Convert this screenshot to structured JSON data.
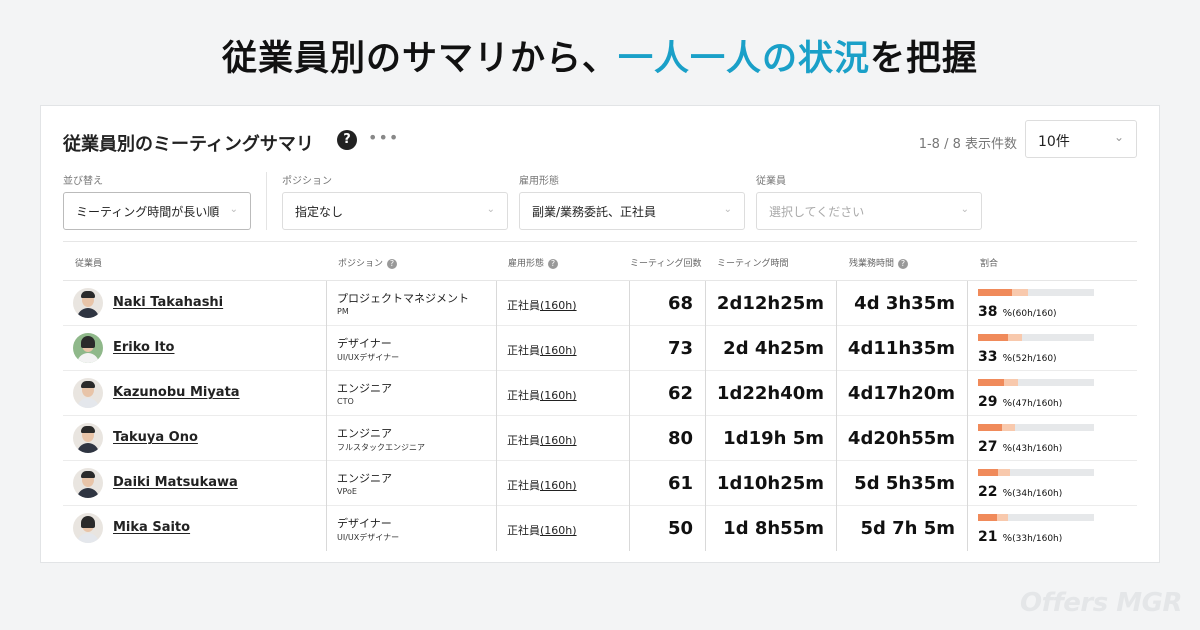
{
  "headline": {
    "prefix": "従業員別のサマリから、",
    "accent": "一人一人の状況",
    "suffix": "を把握"
  },
  "card": {
    "title": "従業員別のミーティングサマリ",
    "help_icon": "question-circle-icon",
    "more_icon": "more-horizontal-icon",
    "pager_text": "1-8 / 8  表示件数",
    "per_page": "10件"
  },
  "filters": [
    {
      "label": "並び替え",
      "value": "ミーティング時間が長い順",
      "placeholder": false
    },
    {
      "label": "ポジション",
      "value": "指定なし",
      "placeholder": false
    },
    {
      "label": "雇用形態",
      "value": "副業/業務委託、正社員",
      "placeholder": false
    },
    {
      "label": "従業員",
      "value": "選択してください",
      "placeholder": true
    }
  ],
  "table": {
    "headers": {
      "employee": "従業員",
      "position": "ポジション",
      "employment": "雇用形態",
      "meeting_count": "ミーティング回数",
      "meeting_time": "ミーティング時間",
      "overtime": "残業務時間",
      "ratio": "割合"
    },
    "rows": [
      {
        "name": "Naki Takahashi",
        "position": "プロジェクトマネジメント",
        "position_sub": "PM",
        "employment": "正社員",
        "employment_hours": "(160h)",
        "count": "68",
        "meeting_time": "2d12h25m",
        "overtime": "4d 3h35m",
        "ratio": 38,
        "ratio_pct": "38",
        "ratio_detail": "(60h/160)",
        "avatar": "male"
      },
      {
        "name": "Eriko Ito",
        "position": "デザイナー",
        "position_sub": "UI/UXデザイナー",
        "employment": "正社員",
        "employment_hours": "(160h)",
        "count": "73",
        "meeting_time": "2d 4h25m",
        "overtime": "4d11h35m",
        "ratio": 33,
        "ratio_pct": "33",
        "ratio_detail": "(52h/160)",
        "avatar": "female-green"
      },
      {
        "name": "Kazunobu Miyata",
        "position": "エンジニア",
        "position_sub": "CTO",
        "employment": "正社員",
        "employment_hours": "(160h)",
        "count": "62",
        "meeting_time": "1d22h40m",
        "overtime": "4d17h20m",
        "ratio": 29,
        "ratio_pct": "29",
        "ratio_detail": "(47h/160h)",
        "avatar": "male-white"
      },
      {
        "name": "Takuya Ono",
        "position": "エンジニア",
        "position_sub": "フルスタックエンジニア",
        "employment": "正社員",
        "employment_hours": "(160h)",
        "count": "80",
        "meeting_time": "1d19h 5m",
        "overtime": "4d20h55m",
        "ratio": 27,
        "ratio_pct": "27",
        "ratio_detail": "(43h/160h)",
        "avatar": "male"
      },
      {
        "name": "Daiki Matsukawa",
        "position": "エンジニア",
        "position_sub": "VPoE",
        "employment": "正社員",
        "employment_hours": "(160h)",
        "count": "61",
        "meeting_time": "1d10h25m",
        "overtime": "5d 5h35m",
        "ratio": 22,
        "ratio_pct": "22",
        "ratio_detail": "(34h/160h)",
        "avatar": "male"
      },
      {
        "name": "Mika Saito",
        "position": "デザイナー",
        "position_sub": "UI/UXデザイナー",
        "employment": "正社員",
        "employment_hours": "(160h)",
        "count": "50",
        "meeting_time": "1d 8h55m",
        "overtime": "5d 7h 5m",
        "ratio": 21,
        "ratio_pct": "21",
        "ratio_detail": "(33h/160h)",
        "avatar": "female-white"
      }
    ]
  },
  "watermark": "Offers MGR",
  "colors": {
    "accent": "#1aa0c8",
    "bar_primary": "#f08a5a",
    "bar_secondary": "#f8c9ad",
    "bar_track": "#e6e8ea"
  }
}
